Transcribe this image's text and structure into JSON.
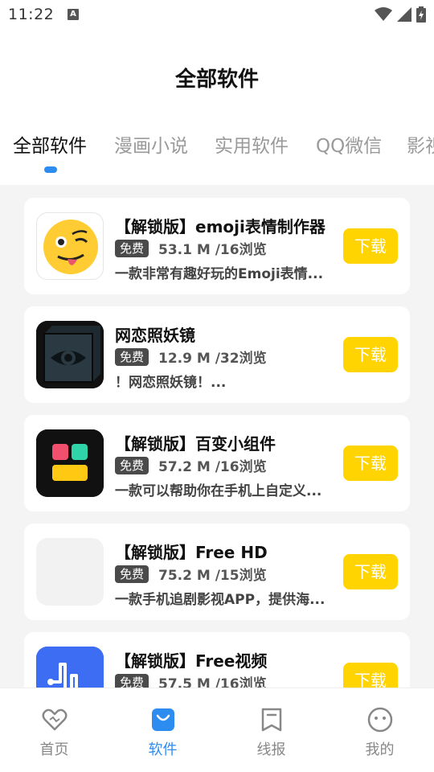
{
  "status_bar": {
    "time": "11:22",
    "badge": "A"
  },
  "header": {
    "title": "全部软件"
  },
  "tabs": [
    {
      "label": "全部软件",
      "active": true
    },
    {
      "label": "漫画小说",
      "active": false
    },
    {
      "label": "实用软件",
      "active": false
    },
    {
      "label": "QQ微信",
      "active": false
    },
    {
      "label": "影视",
      "active": false
    }
  ],
  "apps": [
    {
      "name": "【解锁版】emoji表情制作器",
      "badge": "免费",
      "meta": "53.1 M /16浏览",
      "desc": "一款非常有趣好玩的Emoji表情...",
      "button": "下载",
      "icon": "emoji-wink-icon"
    },
    {
      "name": "网恋照妖镜",
      "badge": "免费",
      "meta": "12.9 M /32浏览",
      "desc": "！网恋照妖镜！...",
      "button": "下载",
      "icon": "eye-cube-icon"
    },
    {
      "name": "【解锁版】百变小组件",
      "badge": "免费",
      "meta": "57.2 M /16浏览",
      "desc": "一款可以帮助你在手机上自定义...",
      "button": "下载",
      "icon": "widget-blocks-icon"
    },
    {
      "name": "【解锁版】Free HD",
      "badge": "免费",
      "meta": "75.2 M /15浏览",
      "desc": "一款手机追剧影视APP，提供海...",
      "button": "下载",
      "icon": "placeholder-icon"
    },
    {
      "name": "【解锁版】Free视频",
      "badge": "免费",
      "meta": "57.5 M /16浏览",
      "desc": "",
      "button": "下载",
      "icon": "music-wave-icon"
    }
  ],
  "bottom_nav": [
    {
      "label": "首页",
      "icon": "heart-icon",
      "active": false
    },
    {
      "label": "软件",
      "icon": "shopping-bag-icon",
      "active": true
    },
    {
      "label": "线报",
      "icon": "bookmark-icon",
      "active": false
    },
    {
      "label": "我的",
      "icon": "face-icon",
      "active": false
    }
  ],
  "colors": {
    "accent": "#2d8cf0",
    "download": "#ffd400",
    "badge": "#4a4a4a",
    "list_bg": "#f4f4f4"
  }
}
